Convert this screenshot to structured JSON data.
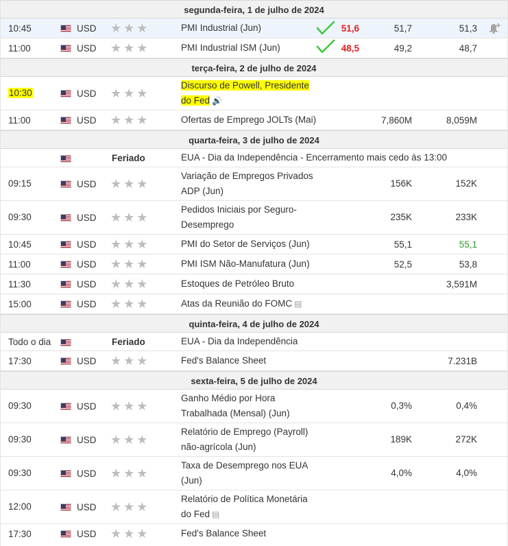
{
  "days": {
    "mon": "segunda-feira, 1 de julho de 2024",
    "tue": "terça-feira, 2 de julho de 2024",
    "wed": "quarta-feira, 3 de julho de 2024",
    "thu": "quinta-feira, 4 de julho de 2024",
    "fri": "sexta-feira, 5 de julho de 2024"
  },
  "rows": [
    {
      "time": "10:45",
      "currency": "USD",
      "event": "PMI Industrial (Jun)",
      "actual": "51,6",
      "forecast": "51,7",
      "previous": "51,3"
    },
    {
      "time": "11:00",
      "currency": "USD",
      "event": "PMI Industrial ISM (Jun)",
      "actual": "48,5",
      "forecast": "49,2",
      "previous": "48,7"
    },
    {
      "time": "10:30",
      "currency": "USD",
      "event_line1": "Discurso de Powell, Presidente",
      "event_line2": "do Fed"
    },
    {
      "time": "11:00",
      "currency": "USD",
      "event": "Ofertas de Emprego JOLTs (Mai)",
      "forecast": "7,860M",
      "previous": "8,059M"
    },
    {
      "importance": "Feriado",
      "event": "EUA - Dia da Independência - Encerramento mais cedo às 13:00"
    },
    {
      "time": "09:15",
      "currency": "USD",
      "event_line1": "Variação de Empregos Privados",
      "event_line2": "ADP (Jun)",
      "forecast": "156K",
      "previous": "152K"
    },
    {
      "time": "09:30",
      "currency": "USD",
      "event_line1": "Pedidos Iniciais por Seguro-",
      "event_line2": "Desemprego",
      "forecast": "235K",
      "previous": "233K"
    },
    {
      "time": "10:45",
      "currency": "USD",
      "event": "PMI do Setor de Serviços (Jun)",
      "forecast": "55,1",
      "previous": "55,1"
    },
    {
      "time": "11:00",
      "currency": "USD",
      "event": "PMI ISM Não-Manufatura (Jun)",
      "forecast": "52,5",
      "previous": "53,8"
    },
    {
      "time": "11:30",
      "currency": "USD",
      "event": "Estoques de Petróleo Bruto",
      "previous": "3,591M"
    },
    {
      "time": "15:00",
      "currency": "USD",
      "event": "Atas da Reunião do FOMC"
    },
    {
      "time": "Todo o dia",
      "importance": "Feriado",
      "event": "EUA - Dia da Independência"
    },
    {
      "time": "17:30",
      "currency": "USD",
      "event": "Fed's Balance Sheet",
      "previous": "7.231B"
    },
    {
      "time": "09:30",
      "currency": "USD",
      "event_line1": "Ganho Médio por Hora",
      "event_line2": "Trabalhada (Mensal) (Jun)",
      "forecast": "0,3%",
      "previous": "0,4%"
    },
    {
      "time": "09:30",
      "currency": "USD",
      "event_line1": "Relatório de Emprego (Payroll)",
      "event_line2": "não-agrícola (Jun)",
      "forecast": "189K",
      "previous": "272K"
    },
    {
      "time": "09:30",
      "currency": "USD",
      "event_line1": "Taxa de Desemprego nos EUA",
      "event_line2": "(Jun)",
      "forecast": "4,0%",
      "previous": "4,0%"
    },
    {
      "time": "12:00",
      "currency": "USD",
      "event_line1": "Relatório de Política Monetária",
      "event_line2": "do Fed"
    },
    {
      "time": "17:30",
      "currency": "USD",
      "event": "Fed's Balance Sheet"
    }
  ],
  "icons": {
    "stars": "★★★",
    "speaker": "🔊",
    "doc": "▤",
    "bell": "🔔"
  },
  "colors": {
    "actual_red": "#e02020",
    "previous_green": "#2e9a2e",
    "check_green": "#3cc93c",
    "highlight": "#ffff00"
  }
}
